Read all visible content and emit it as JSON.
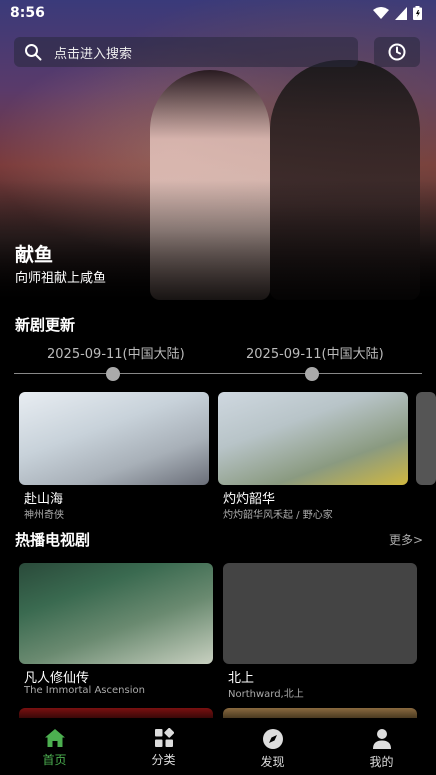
{
  "status_bar": {
    "time": "8:56"
  },
  "search": {
    "placeholder": "点击进入搜索"
  },
  "hero": {
    "title": "献鱼",
    "subtitle": "向师祖献上咸鱼"
  },
  "new_updates": {
    "title": "新剧更新",
    "timeline": [
      {
        "date": "2025-09-11(中国大陆)"
      },
      {
        "date": "2025-09-11(中国大陆)"
      }
    ],
    "items": [
      {
        "title": "赴山海",
        "subtitle": "神州奇侠"
      },
      {
        "title": "灼灼韶华",
        "subtitle": "灼灼韶华风禾起 / 野心家"
      }
    ]
  },
  "hot_tv": {
    "title": "热播电视剧",
    "more": "更多>",
    "items": [
      {
        "title": "凡人修仙传",
        "subtitle": "The Immortal Ascension"
      },
      {
        "title": "北上",
        "subtitle": "Northward,北上"
      }
    ]
  },
  "nav": {
    "items": [
      {
        "label": "首页",
        "icon": "home-icon",
        "active": true
      },
      {
        "label": "分类",
        "icon": "category-icon",
        "active": false
      },
      {
        "label": "发现",
        "icon": "compass-icon",
        "active": false
      },
      {
        "label": "我的",
        "icon": "user-icon",
        "active": false
      }
    ]
  },
  "colors": {
    "accent": "#4caf50",
    "background": "#000000"
  }
}
